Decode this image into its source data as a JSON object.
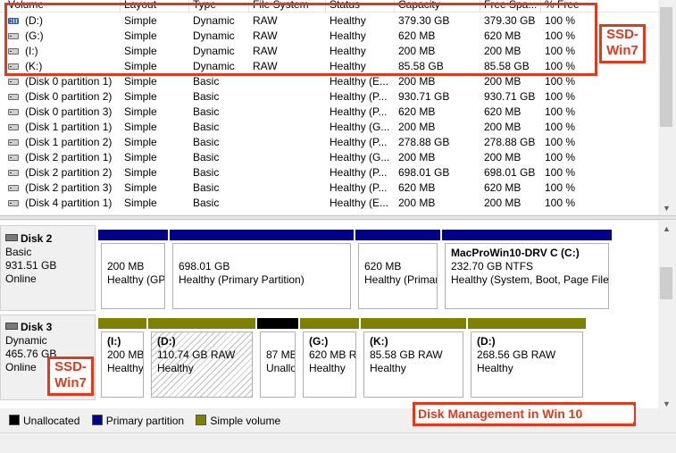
{
  "list": {
    "columns": [
      "Volume",
      "Layout",
      "Type",
      "File System",
      "Status",
      "Capacity",
      "Free Spa...",
      "% Free"
    ],
    "rows": [
      {
        "volume": "(D:)",
        "layout": "Simple",
        "type": "Dynamic",
        "fs": "RAW",
        "status": "Healthy",
        "capacity": "379.30 GB",
        "free": "379.30 GB",
        "pct": "100 %",
        "icon": "striped-volume-icon"
      },
      {
        "volume": "(G:)",
        "layout": "Simple",
        "type": "Dynamic",
        "fs": "RAW",
        "status": "Healthy",
        "capacity": "620 MB",
        "free": "620 MB",
        "pct": "100 %",
        "icon": "volume-icon"
      },
      {
        "volume": "(I:)",
        "layout": "Simple",
        "type": "Dynamic",
        "fs": "RAW",
        "status": "Healthy",
        "capacity": "200 MB",
        "free": "200 MB",
        "pct": "100 %",
        "icon": "volume-icon"
      },
      {
        "volume": "(K:)",
        "layout": "Simple",
        "type": "Dynamic",
        "fs": "RAW",
        "status": "Healthy",
        "capacity": "85.58 GB",
        "free": "85.58 GB",
        "pct": "100 %",
        "icon": "volume-icon"
      },
      {
        "volume": "(Disk 0 partition 1)",
        "layout": "Simple",
        "type": "Basic",
        "fs": "",
        "status": "Healthy (E...",
        "capacity": "200 MB",
        "free": "200 MB",
        "pct": "100 %",
        "icon": "volume-icon"
      },
      {
        "volume": "(Disk 0 partition 2)",
        "layout": "Simple",
        "type": "Basic",
        "fs": "",
        "status": "Healthy (P...",
        "capacity": "930.71 GB",
        "free": "930.71 GB",
        "pct": "100 %",
        "icon": "volume-icon"
      },
      {
        "volume": "(Disk 0 partition 3)",
        "layout": "Simple",
        "type": "Basic",
        "fs": "",
        "status": "Healthy (P...",
        "capacity": "620 MB",
        "free": "620 MB",
        "pct": "100 %",
        "icon": "volume-icon"
      },
      {
        "volume": "(Disk 1 partition 1)",
        "layout": "Simple",
        "type": "Basic",
        "fs": "",
        "status": "Healthy (G...",
        "capacity": "200 MB",
        "free": "200 MB",
        "pct": "100 %",
        "icon": "volume-icon"
      },
      {
        "volume": "(Disk 1 partition 2)",
        "layout": "Simple",
        "type": "Basic",
        "fs": "",
        "status": "Healthy (P...",
        "capacity": "278.88 GB",
        "free": "278.88 GB",
        "pct": "100 %",
        "icon": "volume-icon"
      },
      {
        "volume": "(Disk 2 partition 1)",
        "layout": "Simple",
        "type": "Basic",
        "fs": "",
        "status": "Healthy (G...",
        "capacity": "200 MB",
        "free": "200 MB",
        "pct": "100 %",
        "icon": "volume-icon"
      },
      {
        "volume": "(Disk 2 partition 2)",
        "layout": "Simple",
        "type": "Basic",
        "fs": "",
        "status": "Healthy (P...",
        "capacity": "698.01 GB",
        "free": "698.01 GB",
        "pct": "100 %",
        "icon": "volume-icon"
      },
      {
        "volume": "(Disk 2 partition 3)",
        "layout": "Simple",
        "type": "Basic",
        "fs": "",
        "status": "Healthy (P...",
        "capacity": "620 MB",
        "free": "620 MB",
        "pct": "100 %",
        "icon": "volume-icon"
      },
      {
        "volume": "(Disk 4 partition 1)",
        "layout": "Simple",
        "type": "Basic",
        "fs": "",
        "status": "Healthy (E...",
        "capacity": "200 MB",
        "free": "200 MB",
        "pct": "100 %",
        "icon": "volume-icon"
      }
    ]
  },
  "disk2": {
    "name": "Disk 2",
    "type": "Basic",
    "size": "931.51 GB",
    "status": "Online",
    "partitions": [
      {
        "title": "",
        "size": "200 MB",
        "status": "Healthy (GPT"
      },
      {
        "title": "",
        "size": "698.01 GB",
        "status": "Healthy (Primary Partition)"
      },
      {
        "title": "",
        "size": "620 MB",
        "status": "Healthy (Primar"
      },
      {
        "title": "MacProWin10-DRV C  (C:)",
        "size": "232.70 GB NTFS",
        "status": "Healthy (System, Boot, Page File,"
      }
    ]
  },
  "disk3": {
    "name": "Disk 3",
    "type": "Dynamic",
    "size": "465.76 GB",
    "status": "Online",
    "partitions": [
      {
        "title": "(I:)",
        "size": "200 MB",
        "status": "Healthy"
      },
      {
        "title": "(D:)",
        "size": "110.74 GB RAW",
        "status": "Healthy"
      },
      {
        "title": "",
        "size": "87 MB",
        "status": "Unallo"
      },
      {
        "title": "(G:)",
        "size": "620 MB RA",
        "status": "Healthy"
      },
      {
        "title": "(K:)",
        "size": "85.58 GB RAW",
        "status": "Healthy"
      },
      {
        "title": "(D:)",
        "size": "268.56 GB RAW",
        "status": "Healthy"
      }
    ]
  },
  "legend": {
    "unallocated": "Unallocated",
    "primary": "Primary partition",
    "simple": "Simple volume"
  },
  "annotations": {
    "ssd_top": "SSD-\nWin7",
    "ssd_left": "SSD-\nWin7",
    "caption": "Disk Management in Win 10"
  },
  "colors": {
    "primary": "#00008b",
    "simple": "#808000",
    "unallocated": "#000000",
    "annotation": "#e0391c"
  }
}
